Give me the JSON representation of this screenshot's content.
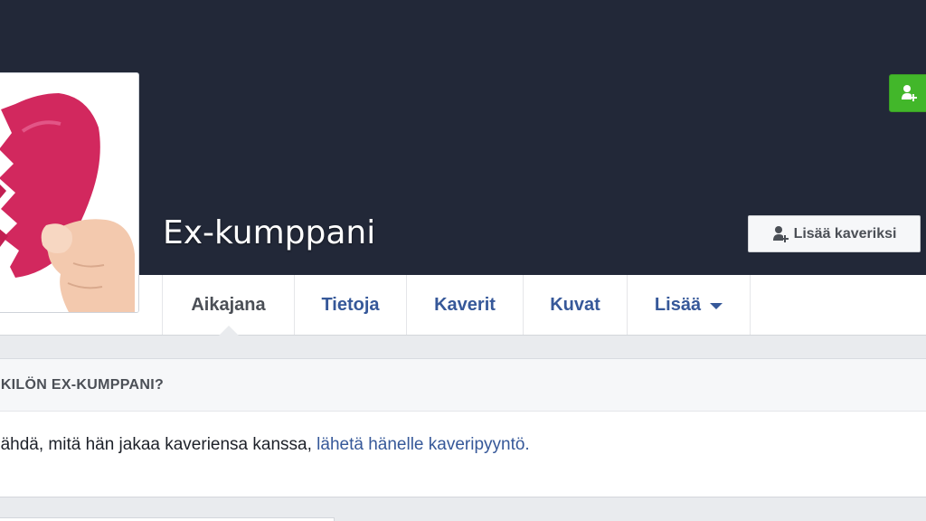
{
  "profile": {
    "name": "Ex-kumppani",
    "add_friend_label": "Lisää kaveriksi"
  },
  "tabs": [
    {
      "label": "Aikajana",
      "active": true
    },
    {
      "label": "Tietoja"
    },
    {
      "label": "Kaverit"
    },
    {
      "label": "Kuvat"
    },
    {
      "label": "Lisää",
      "icon": "caret-down-icon"
    }
  ],
  "know_card": {
    "question_prefix": "ENKILÖN",
    "question_name": "EX-KUMPPANI?",
    "body_text": "nähdä, mitä hän jakaa kaveriensa kanssa,",
    "body_link": "lähetä hänelle kaveripyyntö."
  },
  "colors": {
    "cover": "#222838",
    "link": "#365899",
    "green": "#42b72a",
    "heart": "#d2285e"
  }
}
